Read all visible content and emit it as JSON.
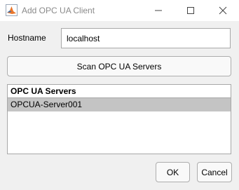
{
  "window": {
    "title": "Add OPC UA Client",
    "app_icon": "matlab-icon",
    "controls": [
      "minimize-icon",
      "maximize-icon",
      "close-icon"
    ]
  },
  "hostname": {
    "label": "Hostname",
    "value": "localhost"
  },
  "scan_button": {
    "label": "Scan OPC UA Servers"
  },
  "servers": {
    "header": "OPC UA Servers",
    "items": [
      {
        "name": "OPCUA-Server001",
        "selected": true
      }
    ]
  },
  "footer": {
    "ok_label": "OK",
    "cancel_label": "Cancel"
  },
  "colors": {
    "window_bg": "#f0f0f0",
    "selected_row": "#c4c4c4",
    "title_text": "#8a8a8a"
  }
}
